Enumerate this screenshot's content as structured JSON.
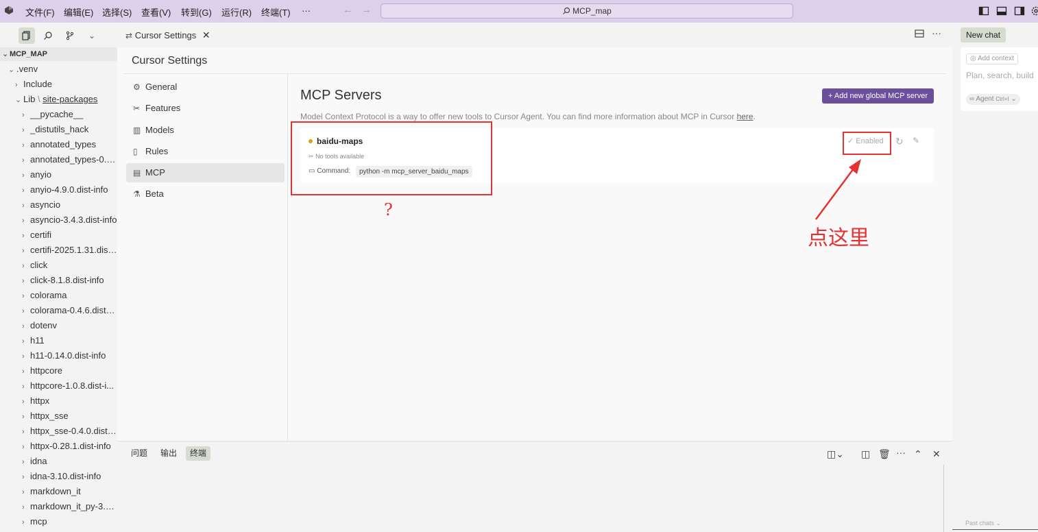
{
  "titlebar": {
    "menu": [
      "文件(F)",
      "编辑(E)",
      "选择(S)",
      "查看(V)",
      "转到(G)",
      "运行(R)",
      "终端(T)",
      "···"
    ],
    "search": "MCP_map"
  },
  "tab": {
    "label": "Cursor Settings"
  },
  "explorer": {
    "root": "MCP_MAP",
    "items": [
      {
        "label": ".venv",
        "indent": 1,
        "expanded": true
      },
      {
        "label": "Include",
        "indent": 2,
        "expanded": false
      },
      {
        "label": "Lib",
        "suffix": "site-packages",
        "indent": 2,
        "expanded": true
      },
      {
        "label": "__pycache__",
        "indent": 3
      },
      {
        "label": "_distutils_hack",
        "indent": 3
      },
      {
        "label": "annotated_types",
        "indent": 3
      },
      {
        "label": "annotated_types-0.7...",
        "indent": 3
      },
      {
        "label": "anyio",
        "indent": 3
      },
      {
        "label": "anyio-4.9.0.dist-info",
        "indent": 3
      },
      {
        "label": "asyncio",
        "indent": 3
      },
      {
        "label": "asyncio-3.4.3.dist-info",
        "indent": 3
      },
      {
        "label": "certifi",
        "indent": 3
      },
      {
        "label": "certifi-2025.1.31.dist...",
        "indent": 3
      },
      {
        "label": "click",
        "indent": 3
      },
      {
        "label": "click-8.1.8.dist-info",
        "indent": 3
      },
      {
        "label": "colorama",
        "indent": 3
      },
      {
        "label": "colorama-0.4.6.dist-i...",
        "indent": 3
      },
      {
        "label": "dotenv",
        "indent": 3
      },
      {
        "label": "h11",
        "indent": 3
      },
      {
        "label": "h11-0.14.0.dist-info",
        "indent": 3
      },
      {
        "label": "httpcore",
        "indent": 3
      },
      {
        "label": "httpcore-1.0.8.dist-i...",
        "indent": 3
      },
      {
        "label": "httpx",
        "indent": 3
      },
      {
        "label": "httpx_sse",
        "indent": 3
      },
      {
        "label": "httpx_sse-0.4.0.dist-i...",
        "indent": 3
      },
      {
        "label": "httpx-0.28.1.dist-info",
        "indent": 3
      },
      {
        "label": "idna",
        "indent": 3
      },
      {
        "label": "idna-3.10.dist-info",
        "indent": 3
      },
      {
        "label": "markdown_it",
        "indent": 3
      },
      {
        "label": "markdown_it_py-3.0...",
        "indent": 3
      },
      {
        "label": "mcp",
        "indent": 3
      }
    ]
  },
  "settings": {
    "title": "Cursor Settings",
    "nav": [
      {
        "label": "General",
        "icon": "gear-icon"
      },
      {
        "label": "Features",
        "icon": "tools-icon"
      },
      {
        "label": "Models",
        "icon": "chart-icon"
      },
      {
        "label": "Rules",
        "icon": "document-icon"
      },
      {
        "label": "MCP",
        "icon": "server-icon",
        "active": true
      },
      {
        "label": "Beta",
        "icon": "flask-icon"
      }
    ],
    "mcp": {
      "title": "MCP Servers",
      "add_button": "+ Add new global MCP server",
      "description": "Model Context Protocol is a way to offer new tools to Cursor Agent. You can find more information about MCP in Cursor ",
      "description_link": "here",
      "description_end": ".",
      "server": {
        "name": "baidu-maps",
        "status_color": "#d4a40a",
        "no_tools": "No tools available",
        "command_label": "Command:",
        "command": "python -m mcp_server_baidu_maps",
        "enabled": "✓ Enabled"
      }
    }
  },
  "annotations": {
    "question": "?",
    "click_here": "点这里",
    "color": "#e53131"
  },
  "panel": {
    "tabs": [
      "问题",
      "输出",
      "终端"
    ],
    "active": "终端"
  },
  "chat": {
    "new_chat": "New chat",
    "add_context": "Add context",
    "placeholder": "Plan, search, build",
    "agent": "∞ Agent",
    "agent_shortcut": "Ctrl+I",
    "past_chats": "Past chats"
  },
  "colors": {
    "titlebar": "#ddd0ea",
    "accent": "#6b4f9c",
    "selected_tab": "#d6dccf"
  }
}
